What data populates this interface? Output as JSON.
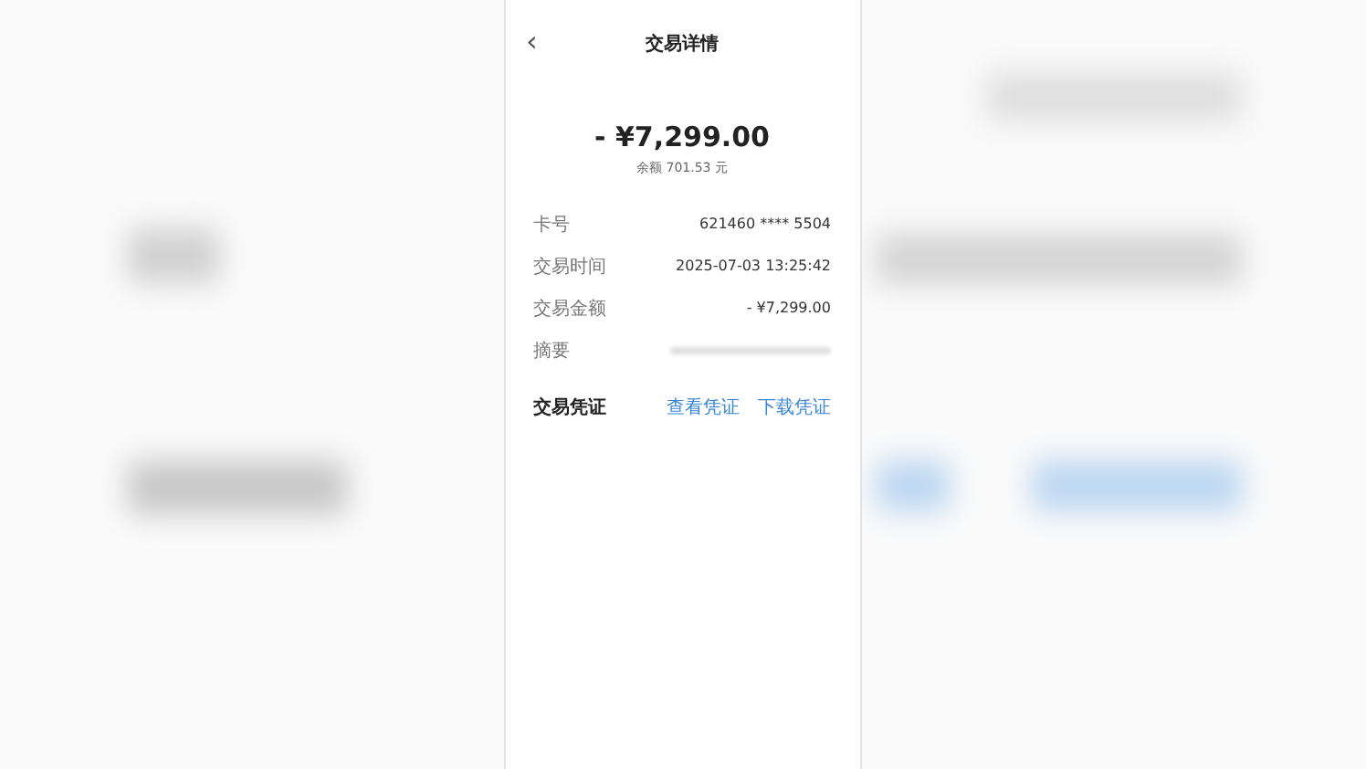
{
  "header": {
    "back": "‹",
    "title": "交易详情"
  },
  "amount": "- ¥7,299.00",
  "balance": "余额 701.53 元",
  "details": [
    {
      "kind": "text",
      "label": "卡号",
      "value": "621460 **** 5504"
    },
    {
      "kind": "text",
      "label": "交易时间",
      "value": "2025-07-03 13:25:42"
    },
    {
      "kind": "text",
      "label": "交易金额",
      "value": "- ¥7,299.00"
    },
    {
      "kind": "redacted",
      "label": "摘要"
    }
  ],
  "voucher": {
    "label": "交易凭证",
    "links": [
      "查看凭证",
      "下载凭证"
    ]
  }
}
